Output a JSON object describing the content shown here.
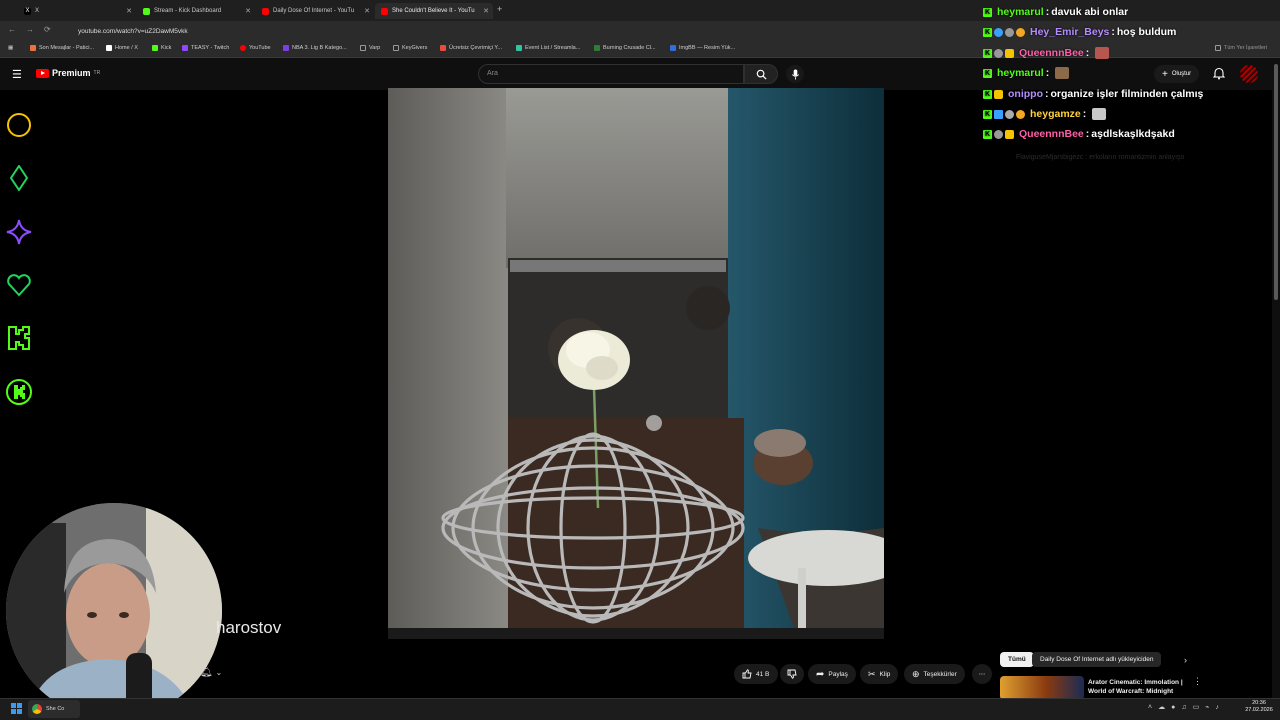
{
  "browser": {
    "tabs": [
      {
        "title": "X",
        "icon": "x-icon",
        "color": "#ffffff"
      },
      {
        "title": "Stream - Kick Dashboard",
        "icon": "kick-icon",
        "color": "#53fc18"
      },
      {
        "title": "Daily Dose Of Internet - YouTu",
        "icon": "youtube-icon",
        "color": "#ff0000"
      },
      {
        "title": "She Couldn't Believe It - YouTu",
        "icon": "youtube-icon",
        "color": "#ff0000"
      }
    ],
    "url": "youtube.com/watch?v=uZ2DawM5vkk",
    "bookmarks": [
      {
        "label": "Son Mesajlar - Patici...",
        "color": "#e9723d"
      },
      {
        "label": "Home / X",
        "color": "#ffffff"
      },
      {
        "label": "Kick",
        "color": "#53fc18"
      },
      {
        "label": "TEASY - Twitch",
        "color": "#9146ff"
      },
      {
        "label": "YouTube",
        "color": "#ff0000"
      },
      {
        "label": "NBA 3. Lig B Katego...",
        "color": "#7b3fe4"
      },
      {
        "label": "Varp",
        "color": "#888888"
      },
      {
        "label": "KeyGivers",
        "color": "#888888"
      },
      {
        "label": "Ücretsiz Çevrimiçi Y...",
        "color": "#e94b3c"
      },
      {
        "label": "Event List / Streamla...",
        "color": "#31c4a0"
      },
      {
        "label": "Burning Crusade Cl...",
        "color": "#2e7d32"
      },
      {
        "label": "ImgBB — Resim Yük...",
        "color": "#2f6fdb"
      }
    ],
    "other_bookmarks": "Tüm Yer İşaretleri"
  },
  "youtube": {
    "brand": "Premium",
    "region": "TR",
    "search_placeholder": "Ara",
    "create_label": "Oluştur",
    "channel_name": "harostov",
    "actions": {
      "like_count": "41 B",
      "share": "Paylaş",
      "clip": "Klip",
      "thanks": "Teşekkürler"
    },
    "chips": [
      "Tümü",
      "Daily Dose Of Internet adlı yükleyiciden"
    ],
    "recommended": {
      "title": "Arator Cinematic: Immolation | World of Warcraft: Midnight"
    }
  },
  "chat": [
    {
      "user": "heymarul",
      "color": "#53fc18",
      "message": "davuk abi onlar",
      "emote": null
    },
    {
      "user": "Hey_Emir_Beys",
      "color": "#b58cff",
      "message": "hoş buldum",
      "emote": null
    },
    {
      "user": "QueennnBee",
      "color": "#ff5fa8",
      "message": "",
      "emote": "#b5574f"
    },
    {
      "user": "heymarul",
      "color": "#53fc18",
      "message": "",
      "emote": "#8a6a4a"
    },
    {
      "user": "onippo",
      "color": "#b58cff",
      "message": "organize işler filminden çalmış",
      "emote": null
    },
    {
      "user": "heygamze",
      "color": "#ffd23f",
      "message": "",
      "emote": "#c8c8c8"
    },
    {
      "user": "QueennnBee",
      "color": "#ff5fa8",
      "message": "aşdlskaşlkdşakd",
      "emote": null
    }
  ],
  "chat_faded": "FlaviguseMjarsbigezc : erkoların romantizmin anlayışo",
  "taskbar": {
    "app_label": "She Co",
    "time": "20:36",
    "date": "27.02.2026"
  }
}
